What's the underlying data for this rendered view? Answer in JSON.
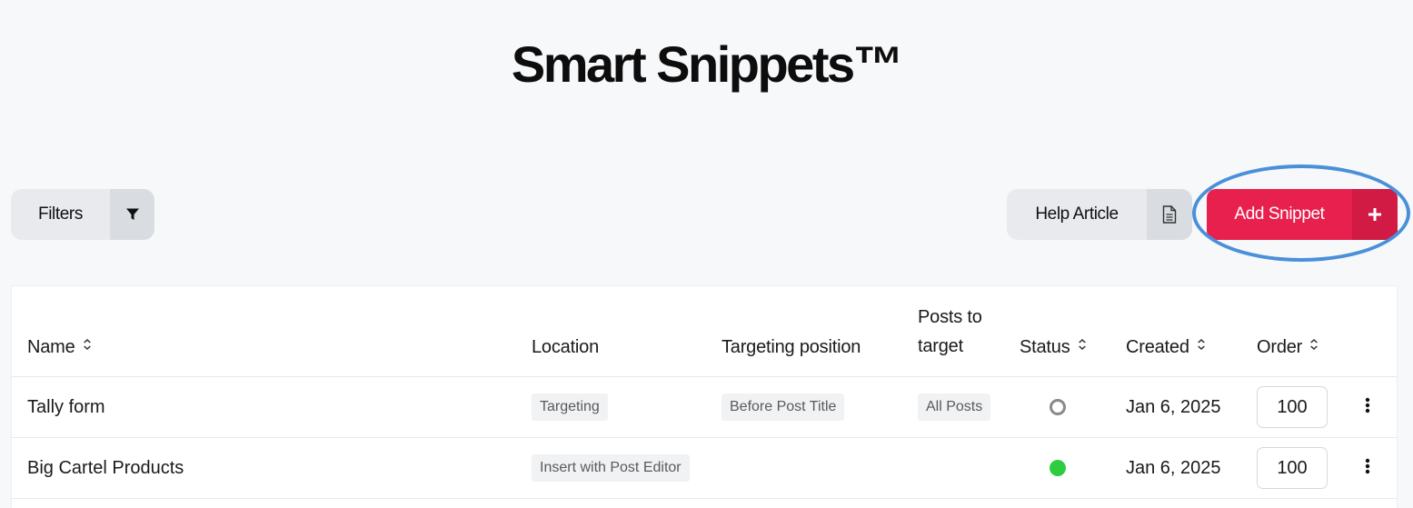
{
  "header": {
    "title": "Smart Snippets™"
  },
  "toolbar": {
    "filters_label": "Filters",
    "help_label": "Help Article",
    "add_label": "Add Snippet",
    "add_icon": "+"
  },
  "colors": {
    "accent": "#e8204e",
    "highlight_ring": "#4a90d9",
    "status_active": "#2ecc40",
    "status_inactive": "#8a8a8a"
  },
  "table": {
    "columns": [
      {
        "label": "Name",
        "sortable": true
      },
      {
        "label": "Location",
        "sortable": false
      },
      {
        "label": "Targeting position",
        "sortable": false
      },
      {
        "label_line1": "Posts to",
        "label_line2": "target",
        "sortable": false
      },
      {
        "label": "Status",
        "sortable": true
      },
      {
        "label": "Created",
        "sortable": true
      },
      {
        "label": "Order",
        "sortable": true
      }
    ],
    "sort_icon": "⌃⌄",
    "rows": [
      {
        "name": "Tally form",
        "location": "Targeting",
        "targeting_position": "Before Post Title",
        "posts_to_target": "All Posts",
        "status": "inactive",
        "created": "Jan 6, 2025",
        "order": "100"
      },
      {
        "name": "Big Cartel Products",
        "location": "Insert with Post Editor",
        "targeting_position": "",
        "posts_to_target": "",
        "status": "active",
        "created": "Jan 6, 2025",
        "order": "100"
      }
    ]
  }
}
